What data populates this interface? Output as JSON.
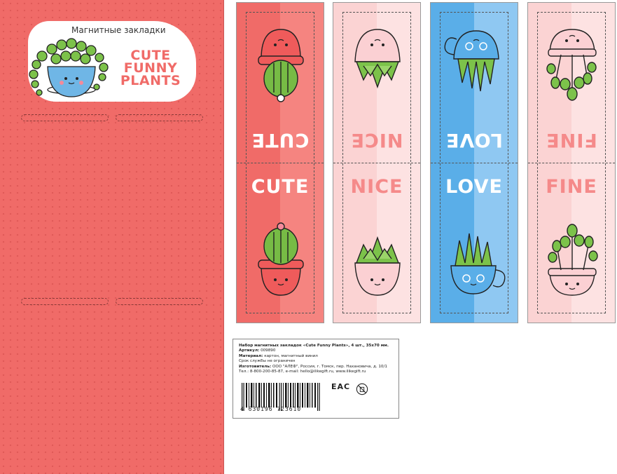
{
  "card": {
    "subtitle": "Магнитные закладки",
    "brand_lines": [
      "CUTE",
      "FUNNY",
      "PLANTS"
    ],
    "colors": {
      "bg": "#f06b68",
      "accent": "#f06b68"
    }
  },
  "bookmarks": [
    {
      "word": "CUTE",
      "bg_left": "#f06b68",
      "bg_right": "#f58480",
      "text_color": "#ffffff",
      "icon_top": "cactus-in-pot-icon",
      "icon_bottom": "cactus-in-pot-icon"
    },
    {
      "word": "NICE",
      "bg_left": "#fbd3d3",
      "bg_right": "#fde2e2",
      "text_color": "#f58a8a",
      "icon_top": "succulent-in-pot-icon",
      "icon_bottom": "succulent-in-pot-icon"
    },
    {
      "word": "LOVE",
      "bg_left": "#5aaee8",
      "bg_right": "#8fc8f2",
      "text_color": "#ffffff",
      "icon_top": "plant-in-cup-icon",
      "icon_bottom": "plant-in-cup-icon"
    },
    {
      "word": "FINE",
      "bg_left": "#fbd3d3",
      "bg_right": "#fde2e2",
      "text_color": "#f58a8a",
      "icon_top": "leafy-plant-in-pot-icon",
      "icon_bottom": "leafy-plant-in-pot-icon"
    }
  ],
  "info": {
    "line1": "Набор магнитных закладок «Cute Funny Plants», 4 шт., 35х70 мм.",
    "line2_label": "Артикул:",
    "line2_value": "009890",
    "line3_label": "Материал:",
    "line3_value": "картон, магнитный винил",
    "line4": "Срок службы не ограничен",
    "line5_label": "Изготовитель:",
    "line5_value": "ООО \"АЛЕФ\", Россия, г. Томск, пер. Нахановича, д. 10/1",
    "line6": "Тел.: 8-800-200-85-87, e-mail: hello@ilikegift.ru, www.ilikegift.ru",
    "barcode_number": "4 630196 723610",
    "eac": "EAC"
  }
}
